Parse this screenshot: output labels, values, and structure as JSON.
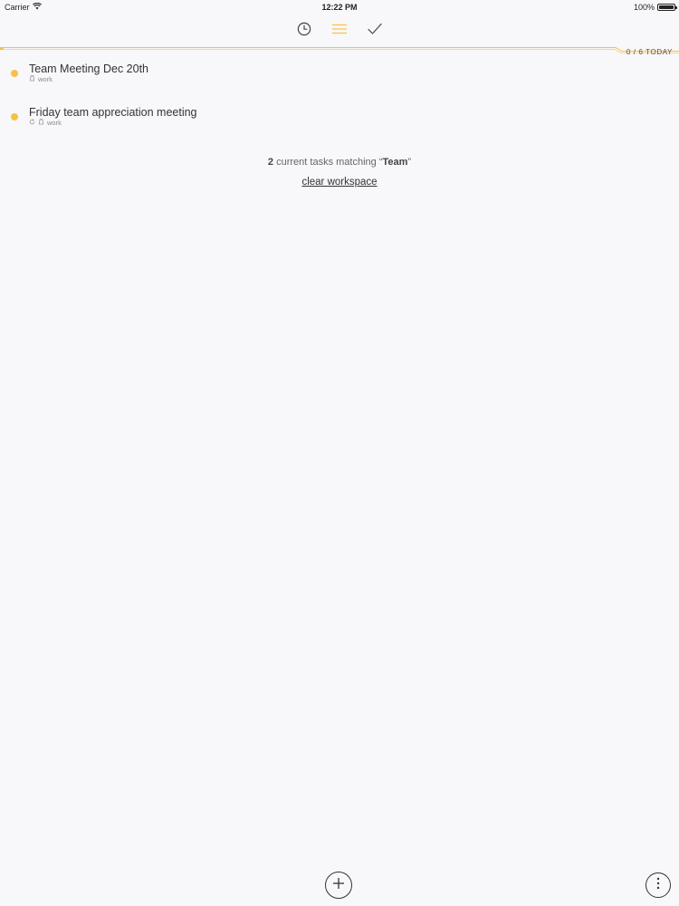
{
  "status_bar": {
    "carrier": "Carrier",
    "time": "12:22 PM",
    "battery": "100%"
  },
  "toolbar": {
    "items": [
      {
        "name": "upcoming",
        "icon": "clock-icon",
        "active": false
      },
      {
        "name": "current",
        "icon": "list-icon",
        "active": true
      },
      {
        "name": "completed",
        "icon": "checkmark-icon",
        "active": false
      }
    ]
  },
  "progress": {
    "today_label": "0 / 6 TODAY",
    "accent": "#f6c245"
  },
  "tasks": [
    {
      "title": "Team Meeting Dec 20th",
      "tag": "work",
      "repeating": false
    },
    {
      "title": "Friday team appreciation meeting",
      "tag": "work",
      "repeating": true
    }
  ],
  "search": {
    "count": "2",
    "text_mid": " current tasks matching “",
    "query": "Team",
    "text_end": "”",
    "clear_label": "clear workspace"
  },
  "colors": {
    "background": "#f8f7f9",
    "accent": "#f6c245",
    "text": "#333333"
  }
}
